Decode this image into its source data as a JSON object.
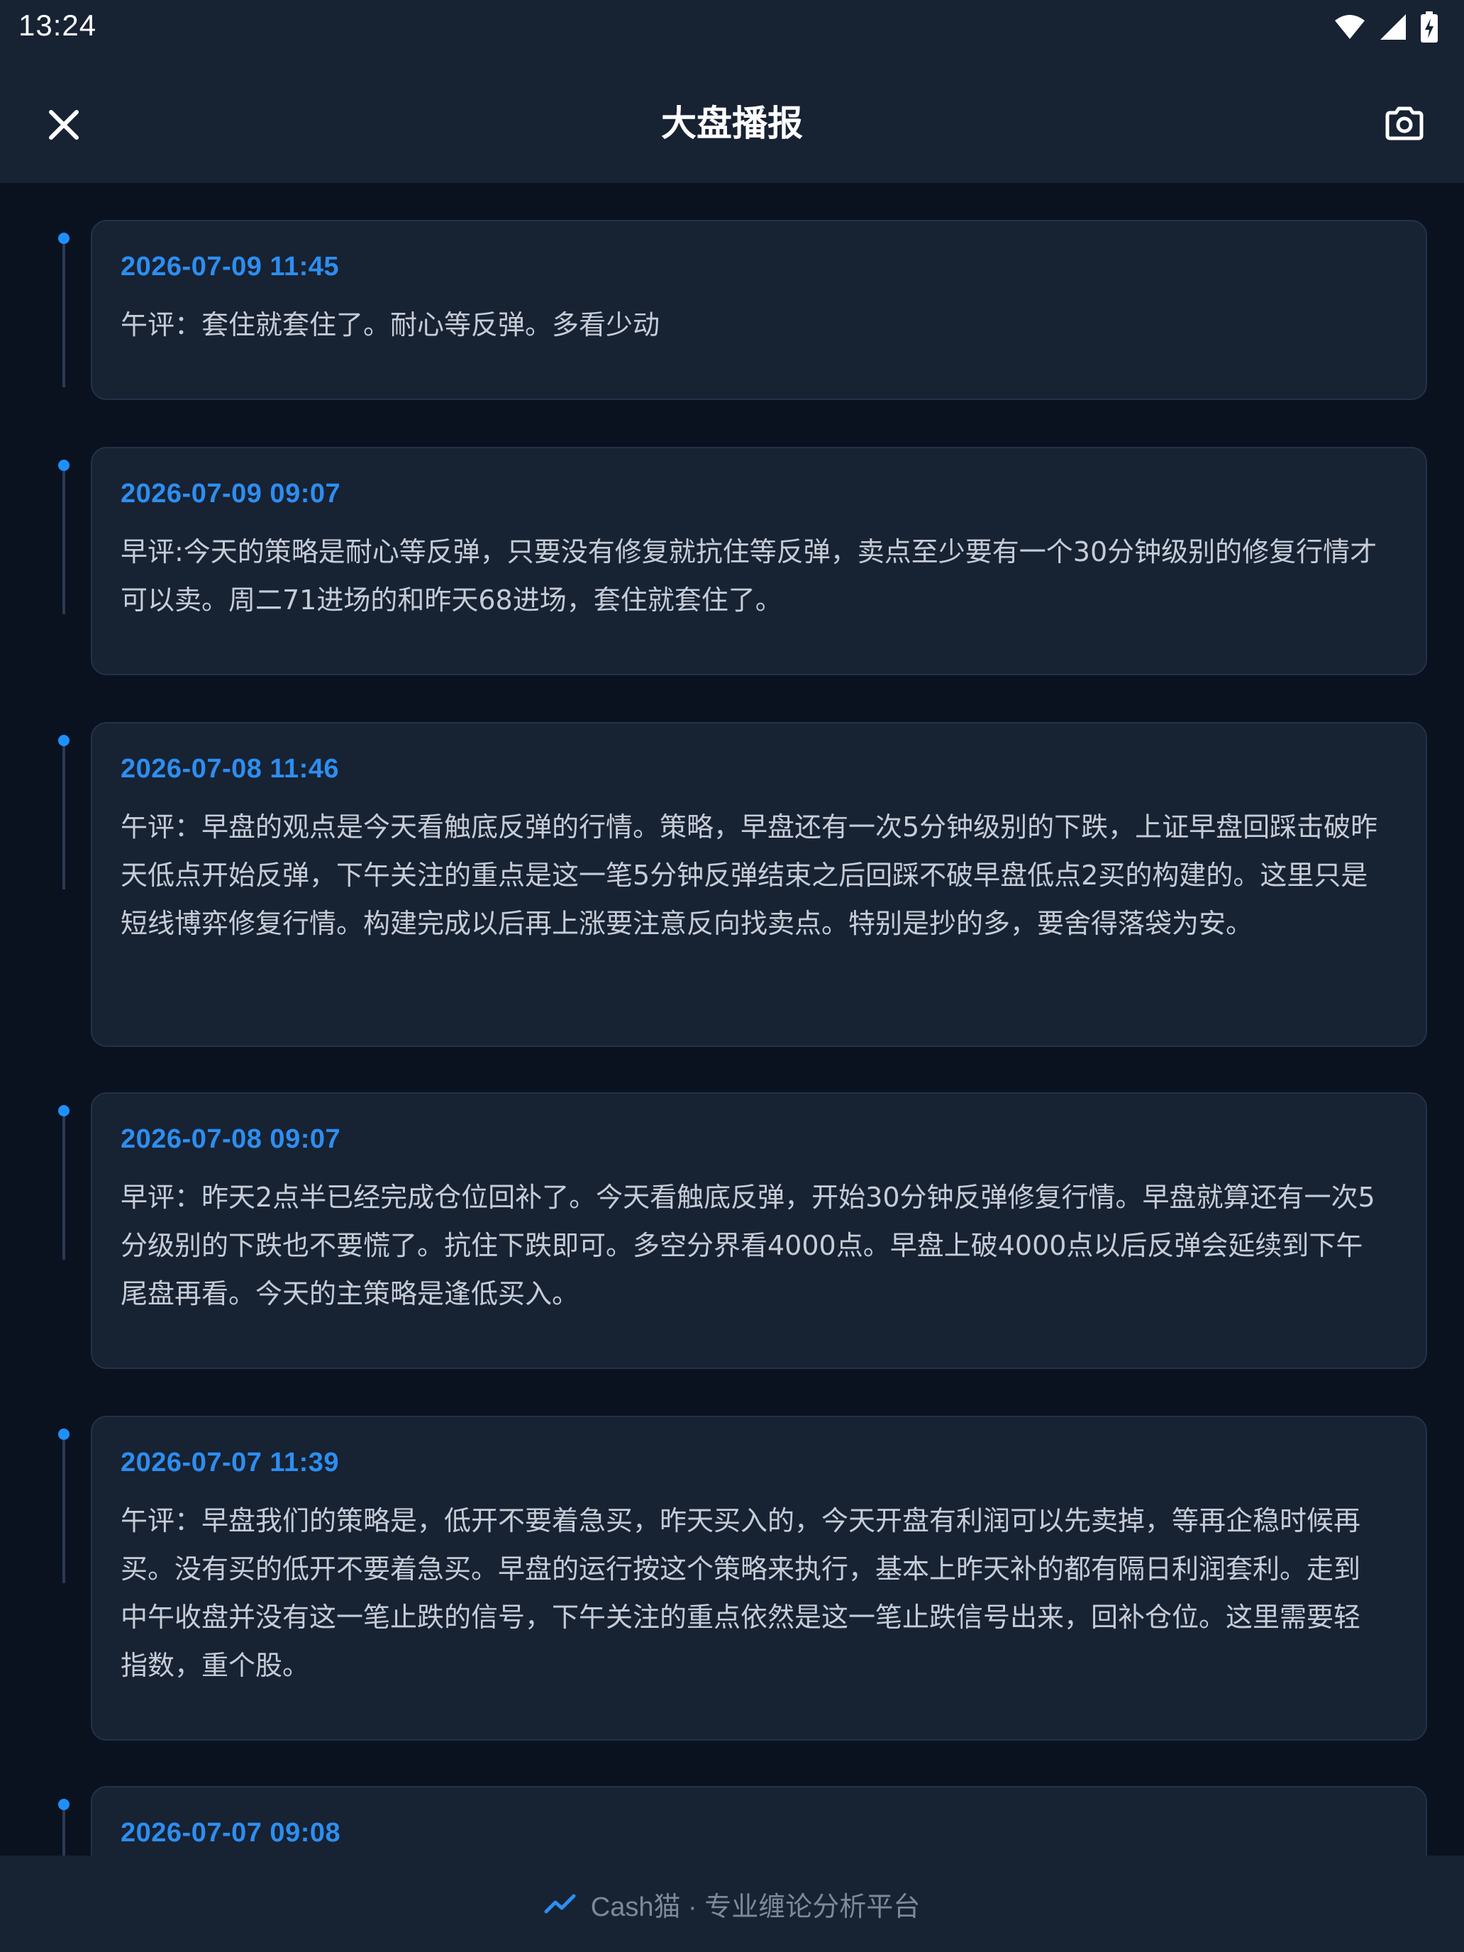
{
  "status_bar": {
    "time": "13:24",
    "icons": [
      "wifi-icon",
      "signal-icon",
      "battery-charging-icon"
    ]
  },
  "header": {
    "title": "大盘播报",
    "close_icon": "close-icon",
    "camera_icon": "camera-icon"
  },
  "colors": {
    "background": "#0a1220",
    "surface": "#172233",
    "accent": "#2d8ef0",
    "text": "#c6ccd6",
    "muted": "#7d8899"
  },
  "entries": [
    {
      "time": "2026-07-09 11:45",
      "content": "午评：套住就套住了。耐心等反弹。多看少动"
    },
    {
      "time": "2026-07-09 09:07",
      "content": "早评:今天的策略是耐心等反弹，只要没有修复就抗住等反弹，卖点至少要有一个30分钟级别的修复行情才可以卖。周二71进场的和昨天68进场，套住就套住了。"
    },
    {
      "time": "2026-07-08 11:46",
      "content": "午评：早盘的观点是今天看触底反弹的行情。策略，早盘还有一次5分钟级别的下跌，上证早盘回踩击破昨天低点开始反弹，下午关注的重点是这一笔5分钟反弹结束之后回踩不破早盘低点2买的构建的。这里只是短线博弈修复行情。构建完成以后再上涨要注意反向找卖点。特别是抄的多，要舍得落袋为安。"
    },
    {
      "time": "2026-07-08 09:07",
      "content": "早评：昨天2点半已经完成仓位回补了。今天看触底反弹，开始30分钟反弹修复行情。早盘就算还有一次5分级别的下跌也不要慌了。抗住下跌即可。多空分界看4000点。早盘上破4000点以后反弹会延续到下午尾盘再看。今天的主策略是逢低买入。"
    },
    {
      "time": "2026-07-07 11:39",
      "content": "午评：早盘我们的策略是，低开不要着急买，昨天买入的，今天开盘有利润可以先卖掉，等再企稳时候再买。没有买的低开不要着急买。早盘的运行按这个策略来执行，基本上昨天补的都有隔日利润套利。走到中午收盘并没有这一笔止跌的信号，下午关注的重点依然是这一笔止跌信号出来，回补仓位。这里需要轻指数，重个股。"
    },
    {
      "time": "2026-07-07 09:08",
      "content": ""
    }
  ],
  "footer": {
    "icon": "trend-chart-icon",
    "text": "Cash猫 · 专业缠论分析平台"
  }
}
